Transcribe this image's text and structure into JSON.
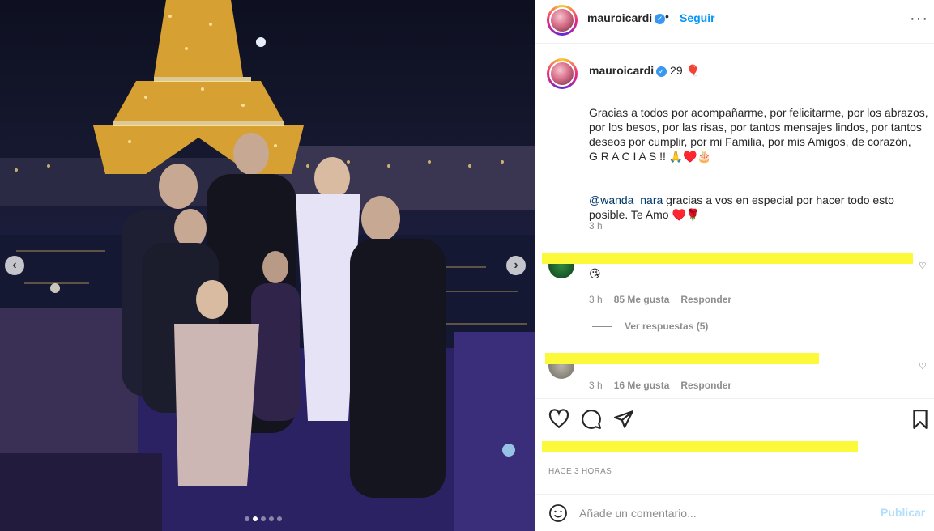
{
  "post": {
    "username": "mauroicardi",
    "follow_label": "Seguir",
    "header_separator": "•",
    "more_label": "···"
  },
  "caption": {
    "username": "mauroicardi",
    "headline": "29 🎈",
    "body": "Gracias a todos por acompañarme, por felicitarme, por los abrazos, por los besos, por las risas, por tantos mensajes lindos, por tantos deseos por cumplir, por mi Familia, por mis Amigos, de corazón,\nG R A C I A S !! 🙏♥️🎂",
    "mention": "@wanda_nara",
    "mention_text": " gracias a vos en especial por hacer todo esto posible. Te Amo ♥️🌹",
    "time": "3 h"
  },
  "comments": [
    {
      "emoji_line": "😘",
      "time": "3 h",
      "likes": "85 Me gusta",
      "reply_label": "Responder",
      "view_replies": "Ver respuestas (5)"
    },
    {
      "time": "3 h",
      "likes": "16 Me gusta",
      "reply_label": "Responder"
    }
  ],
  "footer": {
    "time_ago": "HACE 3 HORAS",
    "comment_placeholder": "Añade un comentario...",
    "publish_label": "Publicar"
  },
  "carousel": {
    "prev": "‹",
    "next": "›",
    "slide_count": 5,
    "active_slide": 2
  },
  "colors": {
    "accent": "#0095f6",
    "highlight": "#fbf93a",
    "muted": "#8e8e8e"
  }
}
